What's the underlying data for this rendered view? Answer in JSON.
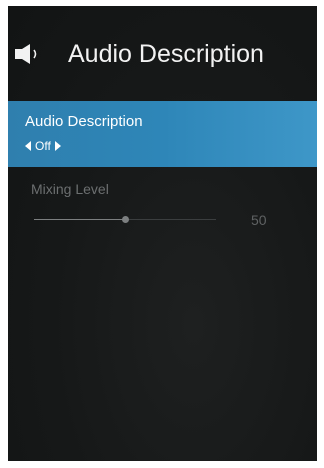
{
  "header": {
    "icon": "speaker-icon",
    "title": "Audio Description"
  },
  "audio_description": {
    "label": "Audio Description",
    "value": "Off"
  },
  "mixing_level": {
    "label": "Mixing Level",
    "value": 50,
    "value_text": "50",
    "min": 0,
    "max": 100
  },
  "colors": {
    "highlight": "#2e86b8",
    "background": "#161818",
    "disabled_text": "#6c6f70"
  }
}
